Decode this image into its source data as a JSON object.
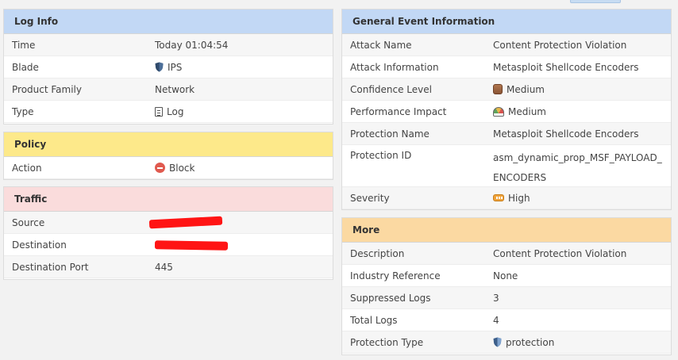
{
  "log_info": {
    "title": "Log Info",
    "rows": [
      {
        "key": "Time",
        "value": "Today 01:04:54"
      },
      {
        "key": "Blade",
        "value": "IPS",
        "icon": "shield-icon"
      },
      {
        "key": "Product Family",
        "value": "Network"
      },
      {
        "key": "Type",
        "value": "Log",
        "icon": "document-icon"
      }
    ]
  },
  "policy": {
    "title": "Policy",
    "rows": [
      {
        "key": "Action",
        "value": "Block",
        "icon": "block-icon"
      }
    ]
  },
  "traffic": {
    "title": "Traffic",
    "rows": [
      {
        "key": "Source",
        "value": "",
        "redacted": true
      },
      {
        "key": "Destination",
        "value": "",
        "redacted": true
      },
      {
        "key": "Destination Port",
        "value": "445"
      }
    ]
  },
  "general": {
    "title": "General Event Information",
    "rows": [
      {
        "key": "Attack Name",
        "value": "Content Protection Violation"
      },
      {
        "key": "Attack Information",
        "value": "Metasploit Shellcode Encoders"
      },
      {
        "key": "Confidence Level",
        "value": "Medium",
        "icon": "database-icon"
      },
      {
        "key": "Performance Impact",
        "value": "Medium",
        "icon": "gauge-icon"
      },
      {
        "key": "Protection Name",
        "value": "Metasploit Shellcode Encoders"
      },
      {
        "key": "Protection ID",
        "value": "asm_dynamic_prop_MSF_PAYLOAD_ENCODERS",
        "value_line1": "asm_dynamic_prop_MSF_PAYLOAD_",
        "value_line2": "ENCODERS"
      },
      {
        "key": "Severity",
        "value": "High",
        "icon": "severity-icon"
      }
    ]
  },
  "more": {
    "title": "More",
    "rows": [
      {
        "key": "Description",
        "value": "Content Protection Violation"
      },
      {
        "key": "Industry Reference",
        "value": "None"
      },
      {
        "key": "Suppressed Logs",
        "value": "3"
      },
      {
        "key": "Total Logs",
        "value": "4"
      },
      {
        "key": "Protection Type",
        "value": "protection",
        "icon": "shield-icon"
      }
    ]
  },
  "colors": {
    "blue_header": "#c2d8f5",
    "yellow_header": "#fde98a",
    "pink_header": "#fadcdc",
    "orange_header": "#fbd9a2",
    "redaction": "#ff1414"
  }
}
